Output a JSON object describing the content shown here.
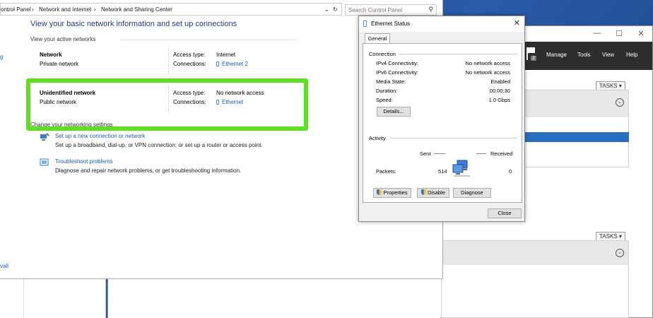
{
  "nsc": {
    "breadcrumb": [
      "ontrol Panel",
      "Network and Internet",
      "Network and Sharing Center"
    ],
    "search_placeholder": "Search Control Panel",
    "left_nav_top": "g",
    "left_nav_bottom": "vall",
    "title": "View your basic network information and set up connections",
    "active_networks_label": "View your active networks",
    "networks": [
      {
        "name": "Network",
        "type": "Private network",
        "access_label": "Access type:",
        "access_value": "Internet",
        "conn_label": "Connections:",
        "conn_value": "Ethernet 2"
      },
      {
        "name": "Unidentified network",
        "type": "Public network",
        "access_label": "Access type:",
        "access_value": "No network access",
        "conn_label": "Connections:",
        "conn_value": "Ethernet"
      }
    ],
    "change_settings_label": "Change your networking settings",
    "tasks": [
      {
        "link": "Set up a new connection or network",
        "desc": "Set up a broadband, dial-up, or VPN connection; or set up a router or access point."
      },
      {
        "link": "Troubleshoot problems",
        "desc": "Diagnose and repair network problems, or get troubleshooting information."
      }
    ]
  },
  "eth": {
    "title": "Ethernet Status",
    "tab": "General",
    "connection_label": "Connection",
    "rows": [
      {
        "k": "IPv4 Connectivity:",
        "v": "No network access"
      },
      {
        "k": "IPv6 Connectivity:",
        "v": "No network access"
      },
      {
        "k": "Media State:",
        "v": "Enabled"
      },
      {
        "k": "Duration:",
        "v": "00:00:30"
      },
      {
        "k": "Speed:",
        "v": "1.0 Gbps"
      }
    ],
    "details_btn": "Details...",
    "activity_label": "Activity",
    "sent_label": "Sent",
    "received_label": "Received",
    "packets_label": "Packets:",
    "packets_sent": "514",
    "packets_received": "0",
    "properties_btn": "Properties",
    "disable_btn": "Disable",
    "diagnose_btn": "Diagnose",
    "close_btn": "Close"
  },
  "sm": {
    "menu": [
      "Manage",
      "Tools",
      "View",
      "Help"
    ],
    "badge": "2",
    "tasks_label": "TASKS"
  },
  "colors": {
    "link": "#1a5fb4",
    "highlight": "#5ce020",
    "title": "#1e3c8c"
  }
}
